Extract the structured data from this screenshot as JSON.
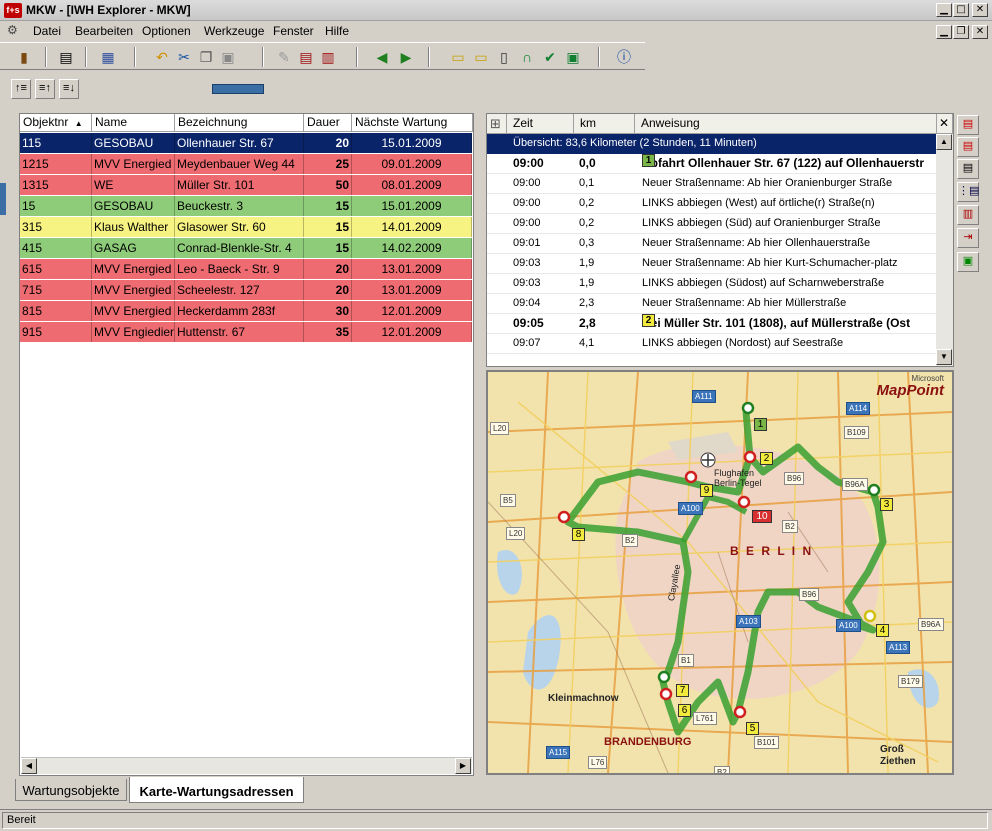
{
  "window": {
    "logo_text": "f+s",
    "title": "MKW - [IWH Explorer - MKW]",
    "controls": {
      "minimize": "▁",
      "maximize": "□",
      "close": "✕",
      "restore": "❐"
    }
  },
  "menu": [
    "Datei",
    "Bearbeiten",
    "Optionen",
    "Werkzeuge",
    "Fenster",
    "Hilfe"
  ],
  "grid": {
    "columns": [
      "Objektnr",
      "Name",
      "Bezeichnung",
      "Dauer",
      "Nächste Wartung"
    ],
    "sort_indicator": "▲",
    "rows": [
      {
        "objektnr": "115",
        "name": "GESOBAU",
        "bezeichnung": "Ollenhauer Str. 67",
        "dauer": "20",
        "wartung": "15.01.2009",
        "status": "selected"
      },
      {
        "objektnr": "1215",
        "name": "MVV Energied",
        "bezeichnung": "Meydenbauer Weg 44",
        "dauer": "25",
        "wartung": "09.01.2009",
        "status": "red"
      },
      {
        "objektnr": "1315",
        "name": "WE",
        "bezeichnung": "Müller Str. 101",
        "dauer": "50",
        "wartung": "08.01.2009",
        "status": "red"
      },
      {
        "objektnr": "15",
        "name": "GESOBAU",
        "bezeichnung": "Beuckestr. 3",
        "dauer": "15",
        "wartung": "15.01.2009",
        "status": "green"
      },
      {
        "objektnr": "315",
        "name": "Klaus Walther",
        "bezeichnung": "Glasower Str. 60",
        "dauer": "15",
        "wartung": "14.01.2009",
        "status": "yellow"
      },
      {
        "objektnr": "415",
        "name": "GASAG",
        "bezeichnung": "Conrad-Blenkle-Str. 4",
        "dauer": "15",
        "wartung": "14.02.2009",
        "status": "green"
      },
      {
        "objektnr": "615",
        "name": "MVV Energied",
        "bezeichnung": "Leo - Baeck - Str. 9",
        "dauer": "20",
        "wartung": "13.01.2009",
        "status": "red"
      },
      {
        "objektnr": "715",
        "name": "MVV Energied",
        "bezeichnung": "Scheelestr. 127",
        "dauer": "20",
        "wartung": "13.01.2009",
        "status": "red"
      },
      {
        "objektnr": "815",
        "name": "MVV Energied",
        "bezeichnung": "Heckerdamm 283f",
        "dauer": "30",
        "wartung": "12.01.2009",
        "status": "red"
      },
      {
        "objektnr": "915",
        "name": "MVV Engiedier",
        "bezeichnung": "Huttenstr. 67",
        "dauer": "35",
        "wartung": "12.01.2009",
        "status": "red"
      }
    ]
  },
  "route": {
    "columns": [
      "Zeit",
      "km",
      "Anweisung"
    ],
    "expand_icon": "⊞",
    "close_icon": "✕",
    "summary": "Übersicht: 83,6 Kilometer (2 Stunden, 11 Minuten)",
    "rows": [
      {
        "zeit": "09:00",
        "km": "0,0",
        "flag": "1",
        "flag_color": "#7ab648",
        "anweisung": "Abfahrt Ollenhauer Str. 67 (122) auf Ollenhauerstr",
        "bold": true
      },
      {
        "zeit": "09:00",
        "km": "0,1",
        "flag": "",
        "anweisung": "Neuer Straßenname: Ab hier Oranienburger Straße",
        "bold": false
      },
      {
        "zeit": "09:00",
        "km": "0,2",
        "flag": "",
        "anweisung": "LINKS abbiegen (West) auf örtliche(r) Straße(n)",
        "bold": false
      },
      {
        "zeit": "09:00",
        "km": "0,2",
        "flag": "",
        "anweisung": "LINKS abbiegen (Süd) auf Oranienburger Straße",
        "bold": false
      },
      {
        "zeit": "09:01",
        "km": "0,3",
        "flag": "",
        "anweisung": "Neuer Straßenname: Ab hier Ollenhauerstraße",
        "bold": false
      },
      {
        "zeit": "09:03",
        "km": "1,9",
        "flag": "",
        "anweisung": "Neuer Straßenname: Ab hier Kurt-Schumacher-platz",
        "bold": false
      },
      {
        "zeit": "09:03",
        "km": "1,9",
        "flag": "",
        "anweisung": "LINKS abbiegen (Südost) auf Scharnweberstraße",
        "bold": false
      },
      {
        "zeit": "09:04",
        "km": "2,3",
        "flag": "",
        "anweisung": "Neuer Straßenname: Ab hier Müllerstraße",
        "bold": false
      },
      {
        "zeit": "09:05",
        "km": "2,8",
        "flag": "2",
        "flag_color": "#f2ea3c",
        "anweisung": "Bei Müller Str. 101 (1808), auf Müllerstraße (Ost",
        "bold": true
      },
      {
        "zeit": "09:07",
        "km": "4,1",
        "flag": "",
        "anweisung": "LINKS abbiegen (Nordost) auf Seestraße",
        "bold": false
      }
    ]
  },
  "map": {
    "brand": "MapPoint",
    "brand_prefix": "Microsoft",
    "city": "B E R L I N",
    "region": "BRANDENBURG",
    "airport": "Flughafen Berlin-Tegel",
    "towns": [
      "Kleinmachnow",
      "Groß Ziethen"
    ],
    "street": "Clayallee",
    "road_labels": [
      "A111",
      "A114",
      "L20",
      "B109",
      "B96",
      "B96A",
      "B5",
      "A100",
      "B2",
      "L20",
      "B2",
      "B96",
      "A103",
      "A100",
      "B96A",
      "A113",
      "B1",
      "B179",
      "L761",
      "A115",
      "L76",
      "B101",
      "B2"
    ],
    "stops": [
      "1",
      "2",
      "3",
      "4",
      "5",
      "6",
      "7",
      "8",
      "9",
      "10"
    ]
  },
  "tabs": [
    "Wartungsobjekte",
    "Karte-Wartungsadressen"
  ],
  "status": "Bereit"
}
